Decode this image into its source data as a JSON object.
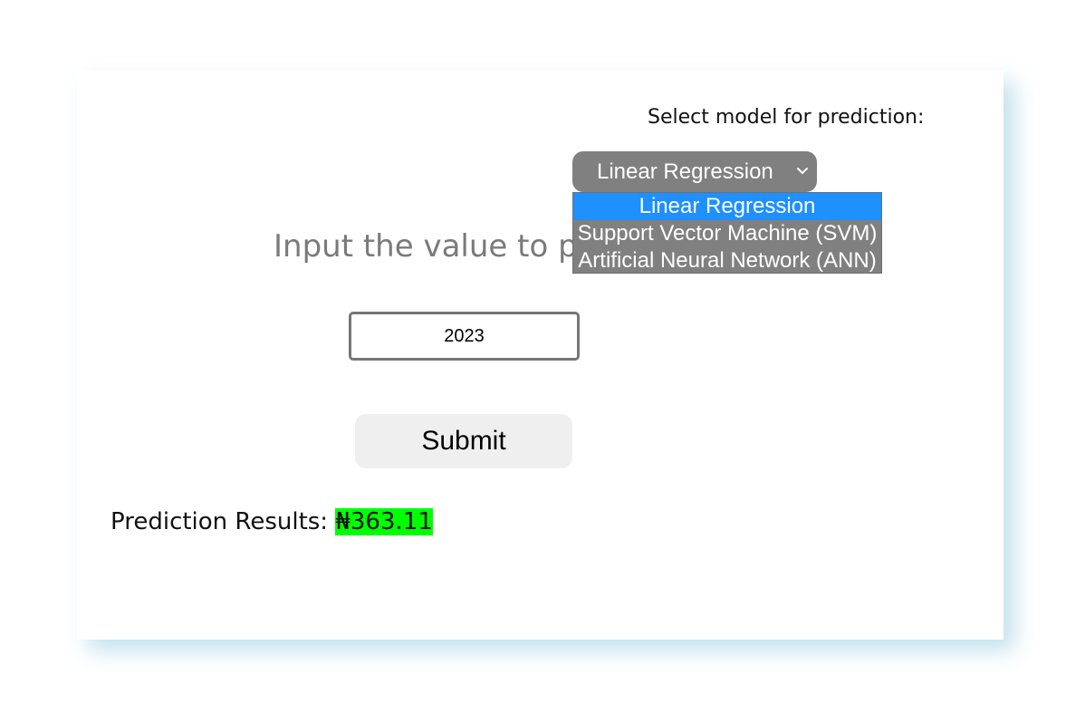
{
  "model_select": {
    "label": "Select model for prediction:",
    "selected_value": "Linear Regression",
    "options": [
      "Linear Regression",
      "Support Vector Machine (SVM)",
      "Artificial Neural Network (ANN)"
    ]
  },
  "form": {
    "heading": "Input the value to pr",
    "input_value": "2023",
    "submit_label": "Submit"
  },
  "result": {
    "label": "Prediction Results: ",
    "value": "₦363.11"
  },
  "colors": {
    "select_bg": "#808080",
    "option_highlight": "#1e90ff",
    "result_highlight": "#00ff00",
    "heading_text": "#7a7a7a",
    "button_bg": "#efefef",
    "card_shadow": "#78bed7"
  }
}
